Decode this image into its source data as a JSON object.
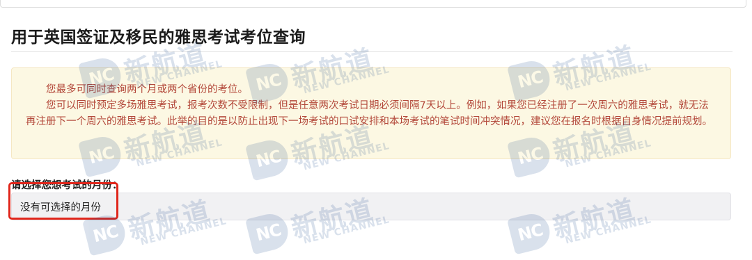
{
  "page": {
    "title": "用于英国签证及移民的雅思考试考位查询"
  },
  "notice": {
    "line1": "您最多可同时查询两个月或两个省份的考位。",
    "line2": "您可以同时预定多场雅思考试，报考次数不受限制，但是任意两次考试日期必须间隔7天以上。例如，如果您已经注册了一次周六的雅思考试，就无法再注册下一个周六的雅思考试。此举的目的是以防止出现下一场考试的口试安排和本场考试的笔试时间冲突情况，建议您在报名时根据自身情况提前规划。",
    "text_color": "#b3483a",
    "background": "#fcf8e3"
  },
  "month_select": {
    "label": "请选择您想考试的月份：",
    "value": "没有可选择的月份"
  },
  "highlight": {
    "color": "#e0261b"
  },
  "watermark": {
    "logo_text": "NC",
    "cn_text": "新航道",
    "en_text": "NEW CHANNEL",
    "color": "#1c4c8c"
  }
}
